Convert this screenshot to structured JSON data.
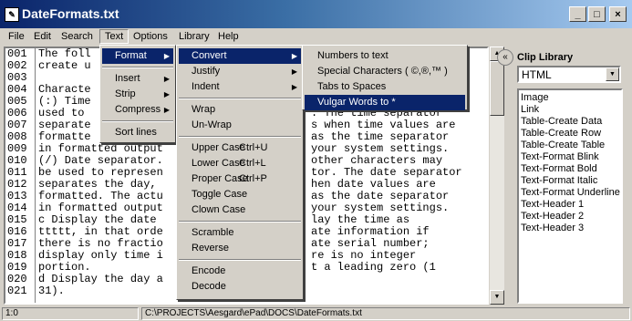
{
  "window": {
    "title": "DateFormats.txt",
    "icon": "notepad-icon",
    "controls": {
      "minimize": "_",
      "maximize": "□",
      "close": "×"
    }
  },
  "menubar": [
    "File",
    "Edit",
    "Search",
    "Text",
    "Options",
    "Library",
    "Help"
  ],
  "editor": {
    "line_numbers": [
      "001",
      "002",
      "003",
      "004",
      "005",
      "006",
      "007",
      "008",
      "009",
      "010",
      "011",
      "012",
      "013",
      "014",
      "015",
      "016",
      "017",
      "018",
      "019",
      "020",
      "021"
    ],
    "lines": [
      "The foll",
      "create u",
      "",
      "Characte",
      "(:) Time",
      "used to",
      "separate",
      "formatte",
      "in formatted output",
      "(/) Date separator.",
      "be used to represen",
      "separates the day,",
      "formatted. The actu",
      "in formatted output",
      "c Display the date",
      "ttttt, in that orde",
      "there is no fractio",
      "display only time i",
      "portion.",
      "d Display the day a",
      "31)."
    ],
    "right_fragments": [
      ". The time separator",
      "s when time values are",
      "as the time separator",
      "your system settings.",
      "other characters may",
      "tor. The date separator",
      "hen date values are",
      "as the date separator",
      "your system settings.",
      "lay the time as",
      "ate information if",
      "ate serial number;",
      "re is no integer",
      "t a leading zero (1"
    ]
  },
  "text_menu": {
    "items": [
      {
        "label": "Format",
        "arrow": true,
        "highlighted": true
      },
      {
        "sep": true
      },
      {
        "label": "Insert",
        "arrow": true
      },
      {
        "label": "Strip",
        "arrow": true
      },
      {
        "label": "Compress",
        "arrow": true
      },
      {
        "sep": true
      },
      {
        "label": "Sort lines"
      }
    ]
  },
  "format_menu": {
    "items": [
      {
        "label": "Convert",
        "arrow": true,
        "highlighted": true
      },
      {
        "label": "Justify",
        "arrow": true
      },
      {
        "label": "Indent",
        "arrow": true
      },
      {
        "sep": true
      },
      {
        "label": "Wrap"
      },
      {
        "label": "Un-Wrap"
      },
      {
        "sep": true
      },
      {
        "label": "Upper Case",
        "shortcut": "Ctrl+U"
      },
      {
        "label": "Lower Case",
        "shortcut": "Ctrl+L"
      },
      {
        "label": "Proper Case",
        "shortcut": "Ctrl+P"
      },
      {
        "label": "Toggle Case"
      },
      {
        "label": "Clown Case"
      },
      {
        "sep": true
      },
      {
        "label": "Scramble"
      },
      {
        "label": "Reverse"
      },
      {
        "sep": true
      },
      {
        "label": "Encode"
      },
      {
        "label": "Decode"
      }
    ]
  },
  "convert_menu": {
    "items": [
      {
        "label": "Numbers to text"
      },
      {
        "label": "Special Characters ( ©,®,™ )"
      },
      {
        "label": "Tabs to Spaces"
      },
      {
        "label": "Vulgar Words to *",
        "highlighted": true
      }
    ]
  },
  "clip_library": {
    "title": "Clip Library",
    "toggle_icon": "double-chevron-left-icon",
    "selected": "HTML",
    "items": [
      "Image",
      "Link",
      "Table-Create Data",
      "Table-Create Row",
      "Table-Create Table",
      "Text-Format Blink",
      "Text-Format Bold",
      "Text-Format Italic",
      "Text-Format Underline",
      "Text-Header 1",
      "Text-Header 2",
      "Text-Header 3"
    ]
  },
  "status": {
    "position": "1:0",
    "path": "C:\\PROJECTS\\Aesgard\\ePad\\DOCS\\DateFormats.txt"
  }
}
